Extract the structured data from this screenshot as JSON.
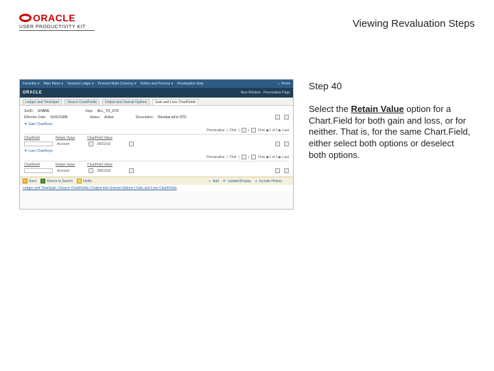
{
  "header": {
    "oracle_word": "ORACLE",
    "upk_line": "USER PRODUCTIVITY KIT",
    "page_title": "Viewing Revaluation Steps"
  },
  "screenshot": {
    "topbar": {
      "items": [
        "Favorites ▾",
        "Main Menu ▾",
        "General Ledger ▾",
        "Process Multi-Currency ▾",
        "Define and Process ▾",
        "Revaluation Step"
      ],
      "home": "Home"
    },
    "orabar": {
      "brand": "ORACLE",
      "right": [
        "New Window",
        "Personalize Page"
      ]
    },
    "tabs": [
      "Ledger and TimeSpan",
      "Source ChartFields",
      "Output and Journal Options",
      "Gain and Loss ChartFields"
    ],
    "active_tab_index": 3,
    "info": {
      "setid_label": "SetID:",
      "setid_val": "SHARE",
      "step_label": "Step:",
      "step_val": "ALL_TO_STD",
      "effdate_label": "Effective Date:",
      "effdate_val": "01/01/1900",
      "status_label": "Status:",
      "status_val": "Active",
      "desc_label": "Description:",
      "desc_val": "Revalue all to STD"
    },
    "grid_tools": {
      "pers": "Personalize",
      "find": "Find",
      "nav": "First ◀ 1 of 1 ▶ Last"
    },
    "sections": {
      "gain": "Gain ChartKeys",
      "loss": "Loss ChartKeys"
    },
    "cols": {
      "cf": "ChartField",
      "rv": "Retain Value",
      "cfv": "ChartField Value"
    },
    "rows": {
      "account": "Account",
      "gain_val": "8001010",
      "loss_val": "8001020"
    },
    "bottom": {
      "save": "Save",
      "return": "Return to Search",
      "notify": "Notify",
      "add": "Add",
      "update": "Update/Display",
      "history": "Include History",
      "timestamp": ""
    },
    "footer_links": "Ledger and TimeSpan | Source ChartFields | Output and Journal Options | Gain and Loss ChartFields"
  },
  "right": {
    "step_label": "Step 40",
    "instr_pre": "Select the ",
    "instr_bold": "Retain Value",
    "instr_post": " option for a Chart.Field for both gain and loss, or for neither. That is, for the same Chart.Field, either select both options or deselect both options."
  }
}
